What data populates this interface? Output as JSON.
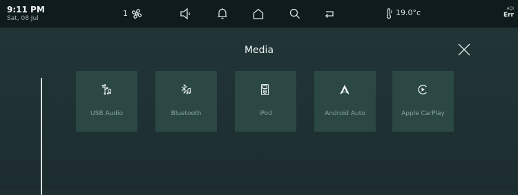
{
  "status": {
    "time": "9:11 PM",
    "date": "Sat, 08 Jul",
    "fan_level": "1",
    "temperature": "19.0°c",
    "aqi_label": "AQI",
    "aqi_value": "Err"
  },
  "header": {
    "title": "Media"
  },
  "sources": [
    {
      "label": "USB Audio",
      "icon": "usb-icon"
    },
    {
      "label": "Bluetooth",
      "icon": "bluetooth-icon"
    },
    {
      "label": "iPod",
      "icon": "ipod-icon"
    },
    {
      "label": "Android Auto",
      "icon": "android-auto-icon"
    },
    {
      "label": "Apple CarPlay",
      "icon": "carplay-icon"
    }
  ],
  "colors": {
    "background": "#1f3133",
    "statusbar": "#101b1d",
    "tile": "#2b4845",
    "tile_label": "#86a5a0"
  }
}
